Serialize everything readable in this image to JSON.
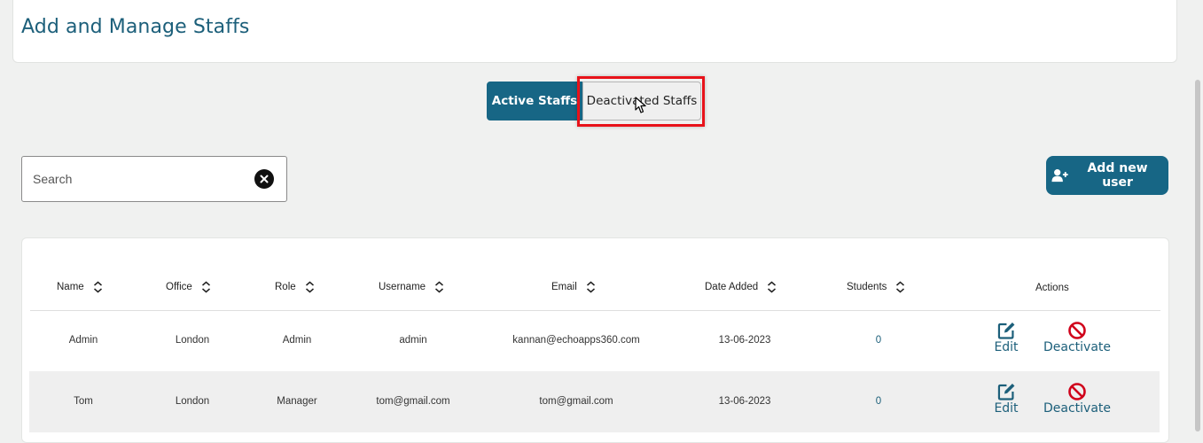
{
  "header": {
    "title": "Add and Manage Staffs"
  },
  "tabs": {
    "active_label": "Active Staffs",
    "inactive_label": "Deactivated Staffs"
  },
  "search": {
    "placeholder": "Search",
    "value": ""
  },
  "add_user_button": {
    "label": "Add new user"
  },
  "table": {
    "columns": [
      "Name",
      "Office",
      "Role",
      "Username",
      "Email",
      "Date Added",
      "Students",
      "Actions"
    ],
    "rows": [
      {
        "name": "Admin",
        "office": "London",
        "role": "Admin",
        "username": "admin",
        "email": "kannan@echoapps360.com",
        "date_added": "13-06-2023",
        "students": "0",
        "edit": "Edit",
        "deactivate": "Deactivate"
      },
      {
        "name": "Tom",
        "office": "London",
        "role": "Manager",
        "username": "tom@gmail.com",
        "email": "tom@gmail.com",
        "date_added": "13-06-2023",
        "students": "0",
        "edit": "Edit",
        "deactivate": "Deactivate"
      }
    ]
  },
  "colors": {
    "primary": "#176685",
    "title": "#1c5f7a",
    "highlight": "#e8121a",
    "deactivate_icon": "#d0021b"
  },
  "icons": [
    "clear-icon",
    "add-user-icon",
    "sort-icon",
    "edit-icon",
    "ban-icon",
    "mouse-cursor-icon"
  ]
}
